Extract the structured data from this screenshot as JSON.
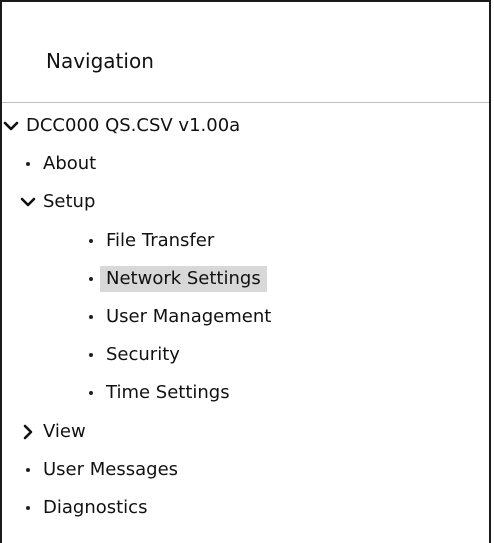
{
  "navigation": {
    "title": "Navigation"
  },
  "tree": {
    "root": {
      "label": "DCC000 QS.CSV v1.00a",
      "expanded": true
    },
    "about": {
      "label": "About"
    },
    "setup": {
      "label": "Setup",
      "expanded": true,
      "children": {
        "file_transfer": {
          "label": "File Transfer"
        },
        "network_settings": {
          "label": "Network Settings",
          "selected": true
        },
        "user_management": {
          "label": "User Management"
        },
        "security": {
          "label": "Security"
        },
        "time_settings": {
          "label": "Time Settings"
        }
      }
    },
    "view": {
      "label": "View",
      "expanded": false
    },
    "user_messages": {
      "label": "User Messages"
    },
    "diagnostics": {
      "label": "Diagnostics"
    }
  },
  "colors": {
    "selected_background": "#d8d8d8",
    "text": "#111111",
    "border": "#1a1a1a"
  }
}
